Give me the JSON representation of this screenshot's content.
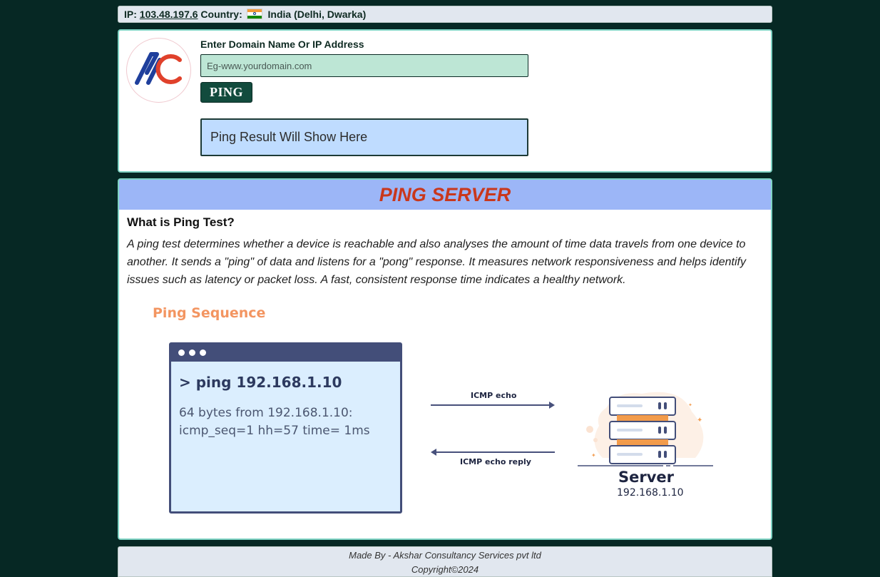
{
  "ip_bar": {
    "ip_label": "IP:",
    "ip": "103.48.197.6",
    "country_label": "Country:",
    "country": "India (Delhi, Dwarka)"
  },
  "form": {
    "logo_icon": "ac-logo",
    "label": "Enter Domain Name Or IP Address",
    "placeholder": "Eg-www.yourdomain.com",
    "value": "",
    "button": "PING",
    "result": "Ping Result Will Show Here"
  },
  "article": {
    "banner": "PING SERVER",
    "heading": "What is Ping Test?",
    "paragraph": "A ping test determines whether a device is reachable and also analyses the amount of time data travels from one device to another. It sends a \"ping\" of data and listens for a \"pong\" response. It measures network responsiveness and helps identify issues such as latency or packet loss. A fast, consistent response time indicates a healthy network."
  },
  "illustration": {
    "title": "Ping Sequence",
    "command": "> ping 192.168.1.10",
    "output_line1": "64 bytes from 192.168.1.10:",
    "output_line2": "icmp_seq=1 hh=57 time= 1ms",
    "echo_label": "ICMP echo",
    "reply_label": "ICMP echo reply",
    "server_label": "Server",
    "server_ip": "192.168.1.10",
    "icons": [
      "terminal-window-icon",
      "server-rack-icon"
    ]
  },
  "footer": {
    "made_by": "Made By - Akshar Consultancy Services pvt ltd",
    "copyright": "Copyright©2024"
  },
  "colors": {
    "page_bg": "#062824",
    "banner_bg": "#9cb6f7",
    "banner_text": "#c9371c",
    "input_bg": "#bde6d5",
    "button_bg": "#124b3d",
    "result_bg": "#bfdcff",
    "sequence_title": "#f39561",
    "terminal_frame": "#434e79"
  }
}
